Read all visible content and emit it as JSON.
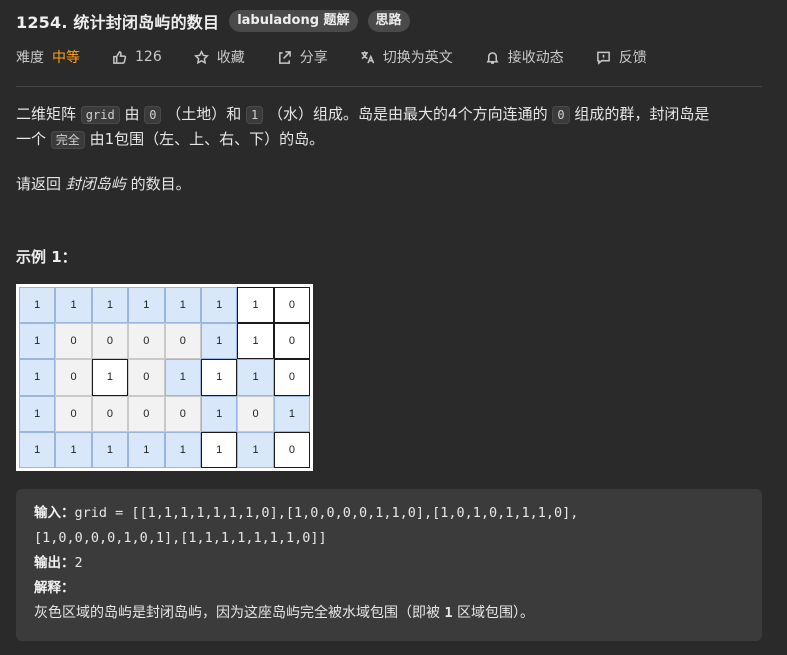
{
  "problem": {
    "title": "1254. 统计封闭岛屿的数目",
    "tags": [
      "labuladong 题解",
      "思路"
    ]
  },
  "meta": {
    "difficulty_label": "难度",
    "difficulty": "中等",
    "likes": "126",
    "favorite": "收藏",
    "share": "分享",
    "switch_lang": "切换为英文",
    "follow": "接收动态",
    "feedback": "反馈"
  },
  "description": {
    "p1_a": "二维矩阵 ",
    "p1_code_grid": "grid",
    "p1_b": " 由 ",
    "p1_code_0": "0",
    "p1_c": " （土地）和 ",
    "p1_code_1": "1",
    "p1_d": " （水）组成。岛是由最大的4个方向连通的 ",
    "p1_code_0b": "0",
    "p1_e": " 组成的群，封闭岛是",
    "p1_f": "一个 ",
    "p1_code_full": "完全",
    "p1_g": " 由1包围（左、上、右、下）的岛。",
    "p2_a": "请返回 ",
    "p2_em": "封闭岛屿",
    "p2_b": " 的数目。"
  },
  "example": {
    "title": "示例 1：",
    "grid": [
      [
        "1",
        "1",
        "1",
        "1",
        "1",
        "1",
        "1",
        "0"
      ],
      [
        "1",
        "0",
        "0",
        "0",
        "0",
        "1",
        "1",
        "0"
      ],
      [
        "1",
        "0",
        "1",
        "0",
        "1",
        "1",
        "1",
        "0"
      ],
      [
        "1",
        "0",
        "0",
        "0",
        "0",
        "1",
        "0",
        "1"
      ],
      [
        "1",
        "1",
        "1",
        "1",
        "1",
        "1",
        "1",
        "0"
      ]
    ],
    "cell_styles": [
      [
        "blue",
        "blue",
        "blue",
        "blue",
        "blue",
        "blue",
        "white",
        "white"
      ],
      [
        "blue",
        "gray",
        "gray",
        "gray",
        "gray",
        "blue",
        "white",
        "white"
      ],
      [
        "blue",
        "gray",
        "white",
        "gray",
        "blue",
        "white",
        "blue",
        "white"
      ],
      [
        "blue",
        "gray",
        "gray",
        "gray",
        "gray",
        "blue",
        "gray",
        "blue"
      ],
      [
        "blue",
        "blue",
        "blue",
        "blue",
        "blue",
        "white",
        "blue",
        "white"
      ]
    ],
    "input_label": "输入：",
    "input_line1": "grid = [[1,1,1,1,1,1,1,0],[1,0,0,0,0,1,1,0],[1,0,1,0,1,1,1,0],",
    "input_line2": "[1,0,0,0,0,1,0,1],[1,1,1,1,1,1,1,0]]",
    "output_label": "输出：",
    "output_value": "2",
    "explain_label": "解释：",
    "explain_a": "灰色区域的岛屿是封闭岛屿，因为这座岛屿完全被水域包围（即被 ",
    "explain_code": "1",
    "explain_b": " 区域包围）。"
  },
  "colors": {
    "background": "#2a2a2a",
    "difficulty": "#ffa116",
    "tag_bg": "#4a4a4a",
    "code_bg": "#3b3b3b"
  }
}
